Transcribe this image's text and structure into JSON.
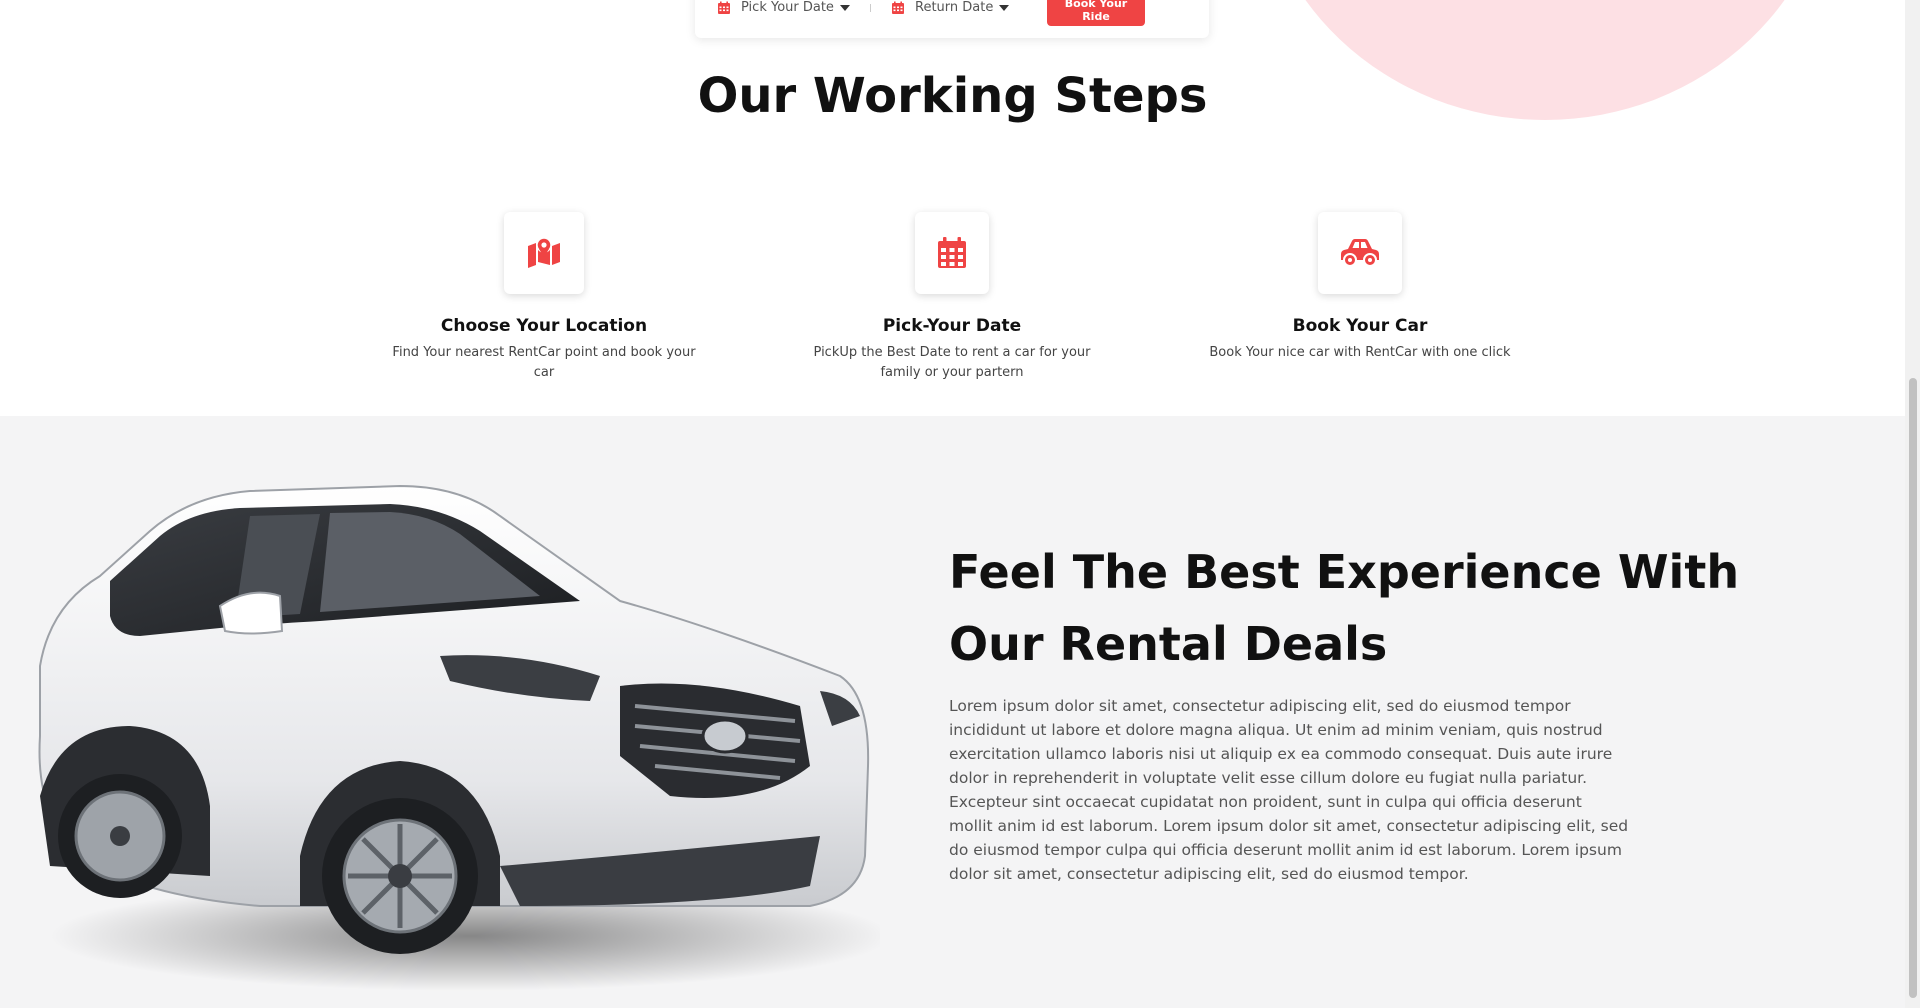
{
  "booking": {
    "pick_date_label": "Pick Your Date",
    "return_date_label": "Return Date",
    "book_button": "Book Your Ride"
  },
  "steps_section": {
    "title": "Our Working Steps",
    "steps": [
      {
        "icon": "map-location-icon",
        "heading": "Choose Your Location",
        "description": "Find Your nearest RentCar point and book your car"
      },
      {
        "icon": "calendar-icon",
        "heading": "Pick-Your Date",
        "description": "PickUp the Best Date to rent a car for your family or your partern"
      },
      {
        "icon": "car-icon",
        "heading": "Book Your Car",
        "description": "Book Your nice car with RentCar with one click"
      }
    ]
  },
  "deal_section": {
    "title": "Feel The Best Experience With Our Rental Deals",
    "paragraph": "Lorem ipsum dolor sit amet, consectetur adipiscing elit, sed do eiusmod tempor incididunt ut labore et dolore magna aliqua. Ut enim ad minim veniam, quis nostrud exercitation ullamco laboris nisi ut aliquip ex ea commodo consequat. Duis aute irure dolor in reprehenderit in voluptate velit esse cillum dolore eu fugiat nulla pariatur. Excepteur sint occaecat cupidatat non proident, sunt in culpa qui officia deserunt mollit anim id est laborum. Lorem ipsum dolor sit amet, consectetur adipiscing elit, sed do eiusmod tempor culpa qui officia deserunt mollit anim id est laborum. Lorem ipsum dolor sit amet, consectetur adipiscing elit, sed do eiusmod tempor."
  },
  "colors": {
    "accent": "#ef4444",
    "pink_blob": "#fde0e4",
    "section_bg": "#f4f4f5"
  }
}
